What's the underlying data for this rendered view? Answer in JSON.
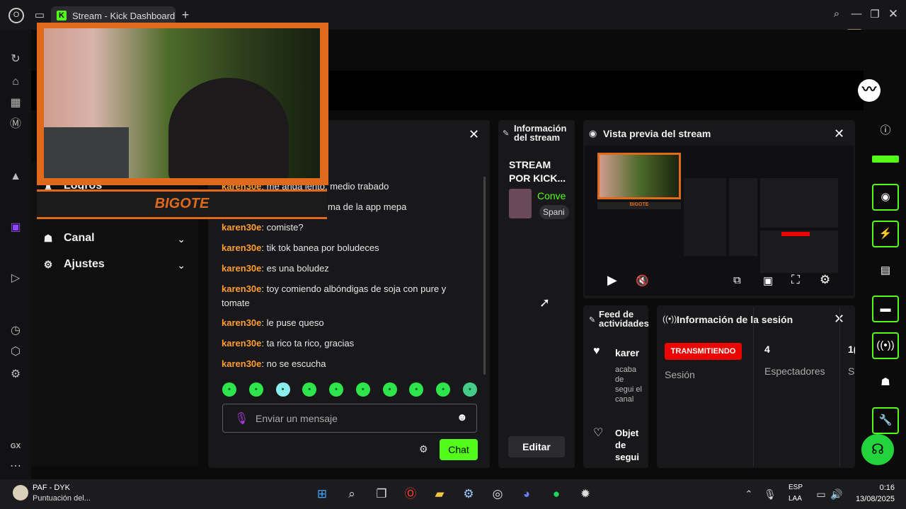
{
  "browser": {
    "tab_title": "Stream - Kick Dashboard",
    "tab_icon": "K",
    "new_tab": "+"
  },
  "sidebar_left_icons": [
    "opera-icon",
    "refresh-icon",
    "shop-icon",
    "gaming-icon",
    "m-icon",
    "triangle-icon",
    "twitch-icon",
    "play-icon",
    "history-icon",
    "extensions-icon",
    "settings-icon",
    "more-icon"
  ],
  "sidebar_left_label_gx": "GX",
  "overlay": {
    "streamer_name": "BIGOTE"
  },
  "nav": {
    "logros": "Logros",
    "canal": "Canal",
    "ajustes": "Ajustes"
  },
  "chat": {
    "messages": [
      {
        "user": "karen30e",
        "text": ": me anda lento, medio trabado"
      },
      {
        "user": "",
        "text": "ma de la app mepa"
      },
      {
        "user": "karen30e",
        "text": ": comiste?"
      },
      {
        "user": "karen30e",
        "text": ": tik tok banea por boludeces"
      },
      {
        "user": "karen30e",
        "text": ": es una boludez"
      },
      {
        "user": "karen30e",
        "text": ": toy comiendo albóndigas de soja con pure y tomate"
      },
      {
        "user": "karen30e",
        "text": ": le puse queso"
      },
      {
        "user": "karen30e",
        "text": ": ta rico ta rico, gracias"
      },
      {
        "user": "karen30e",
        "text": ": no se escucha"
      }
    ],
    "input_placeholder": "Enviar un mensaje",
    "send_label": "Chat"
  },
  "stream_info": {
    "title": "Información del stream",
    "stream_title": "STREAM POR KICK...",
    "category_short": "Conve",
    "language_short": "Spani",
    "edit_label": "Editar"
  },
  "preview": {
    "title": "Vista previa del stream",
    "mini_label": "BIGOTE"
  },
  "feed": {
    "title": "Feed de actividades",
    "item1_user": "karer",
    "item1_text": "acaba de segui el canal",
    "item2_text": "Objet de segui"
  },
  "session": {
    "title": "Información de la sesión",
    "live_badge": "TRANSMITIENDO",
    "session_label": "Sesión",
    "viewers_value": "4",
    "viewers_label": "Espectadores",
    "third_value": "1(",
    "third_label": "S"
  },
  "taskbar": {
    "now_playing_title": "PAF - DYK",
    "now_playing_sub": "Puntuación del...",
    "lang_top": "ESP",
    "lang_bottom": "LAA",
    "time": "0:16",
    "date": "13/08/2025"
  },
  "colors": {
    "kick_green": "#53fc18",
    "username_orange": "#ff9d2e",
    "live_red": "#eb0400",
    "overlay_orange": "#e06a1c"
  }
}
